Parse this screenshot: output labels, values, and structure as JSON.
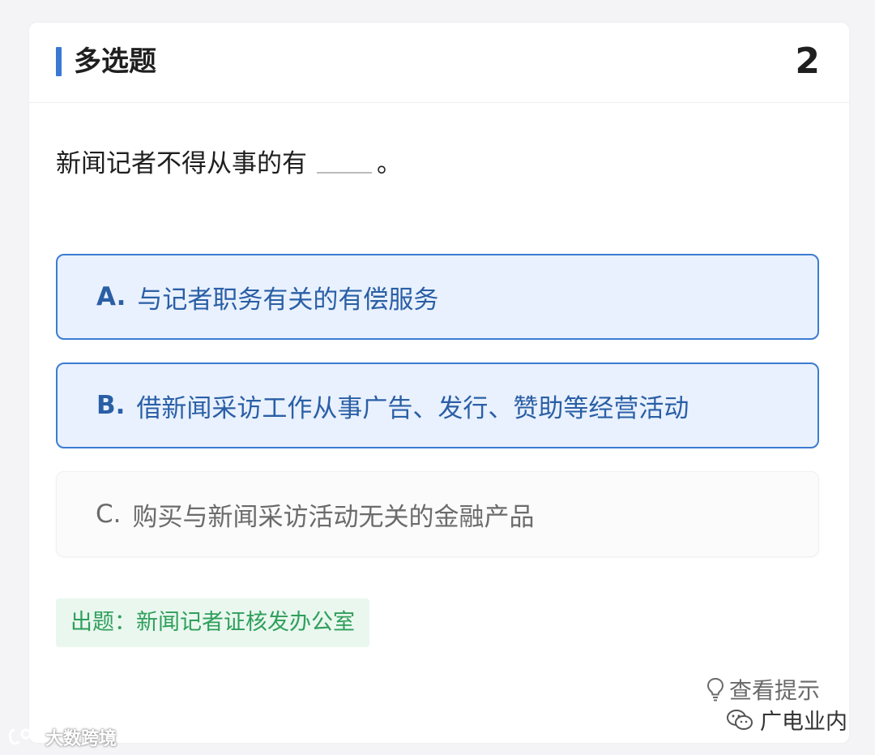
{
  "header": {
    "question_type": "多选题",
    "question_number": "2"
  },
  "question": {
    "text": "新闻记者不得从事的有",
    "end_punct": "。"
  },
  "options": [
    {
      "letter": "A.",
      "text": "与记者职务有关的有偿服务",
      "selected": true
    },
    {
      "letter": "B.",
      "text": "借新闻采访工作从事广告、发行、赞助等经营活动",
      "selected": true
    },
    {
      "letter": "C.",
      "text": "购买与新闻采访活动无关的金融产品",
      "selected": false
    }
  ],
  "source_tag": "出题：新闻记者证核发办公室",
  "hint": {
    "label": "查看提示",
    "icon": "lightbulb-icon"
  },
  "watermarks": {
    "left": "大数跨境",
    "right": "广电业内"
  },
  "colors": {
    "accent": "#3a78d4",
    "selected_bg": "#e9f1fe",
    "selected_border": "#3b7cd2",
    "selected_text": "#2a5fa6",
    "tag_bg": "#eaf7ef",
    "tag_text": "#2e9f5b"
  }
}
